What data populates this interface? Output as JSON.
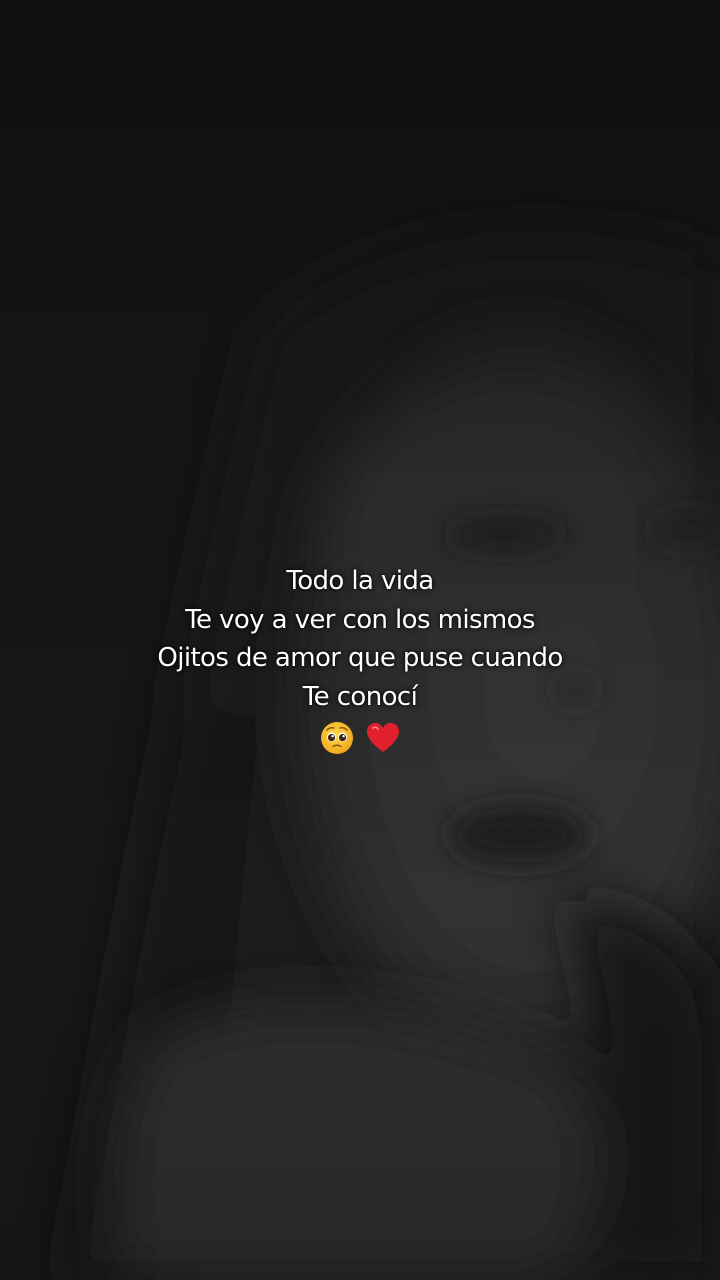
{
  "caption": {
    "lines": [
      "Todo la vida",
      "Te voy a ver con los mismos",
      "Ojitos de amor que puse cuando",
      "Te conocí"
    ],
    "emojis": [
      "pleading-face-icon",
      "red-heart-icon"
    ]
  },
  "colors": {
    "background": "#161616",
    "text": "#ffffff",
    "emoji_face": "#f4b92b",
    "emoji_heart": "#e0212d"
  }
}
